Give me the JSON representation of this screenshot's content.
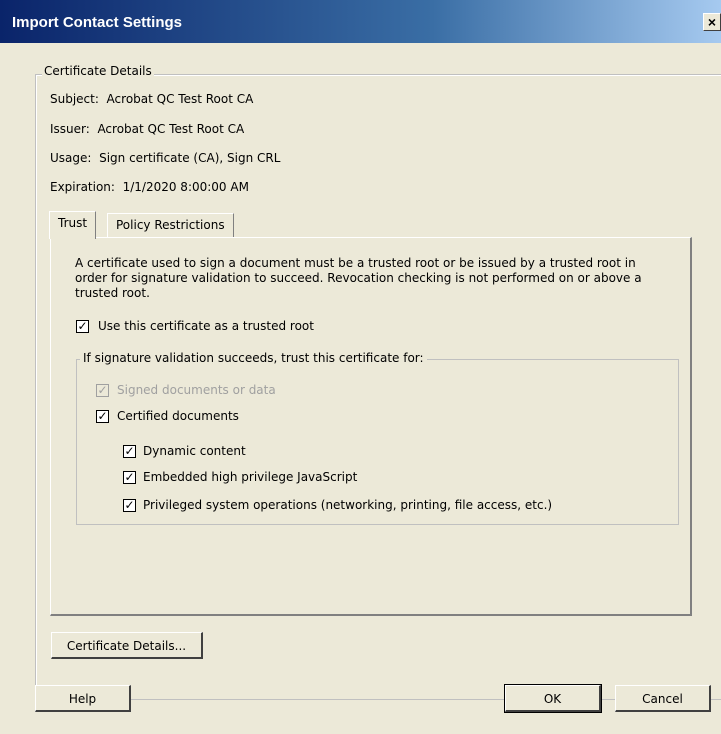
{
  "window": {
    "title": "Import Contact Settings",
    "close_glyph": "×"
  },
  "certificate_details": {
    "legend": "Certificate Details",
    "subject_label": "Subject:",
    "subject_value": "Acrobat QC Test Root CA",
    "issuer_label": "Issuer:",
    "issuer_value": "Acrobat QC Test Root CA",
    "usage_label": "Usage:",
    "usage_value": "Sign certificate (CA), Sign CRL",
    "expiration_label": "Expiration:",
    "expiration_value": "1/1/2020 8:00:00 AM"
  },
  "tabs": [
    {
      "label": "Trust",
      "active": true
    },
    {
      "label": "Policy Restrictions",
      "active": false
    }
  ],
  "trust": {
    "description": "A certificate used to sign a document must be a trusted root or be issued by a trusted root in order for signature validation to succeed.  Revocation checking is not performed on or above a trusted root.",
    "trusted_root": {
      "label": "Use this certificate as a trusted root",
      "checked": true
    },
    "trust_group_legend": "If signature validation succeeds, trust this certificate for:",
    "signed_documents": {
      "label": "Signed documents or data",
      "checked": true,
      "disabled": true
    },
    "certified_documents": {
      "label": "Certified documents",
      "checked": true
    },
    "dynamic_content": {
      "label": "Dynamic content",
      "checked": true
    },
    "javascript": {
      "label": "Embedded high privilege JavaScript",
      "checked": true
    },
    "system_ops": {
      "label": "Privileged system operations (networking, printing, file access, etc.)",
      "checked": true
    },
    "check_glyph": "✓"
  },
  "buttons": {
    "certificate_details": "Certificate Details...",
    "help": "Help",
    "ok": "OK",
    "cancel": "Cancel"
  }
}
